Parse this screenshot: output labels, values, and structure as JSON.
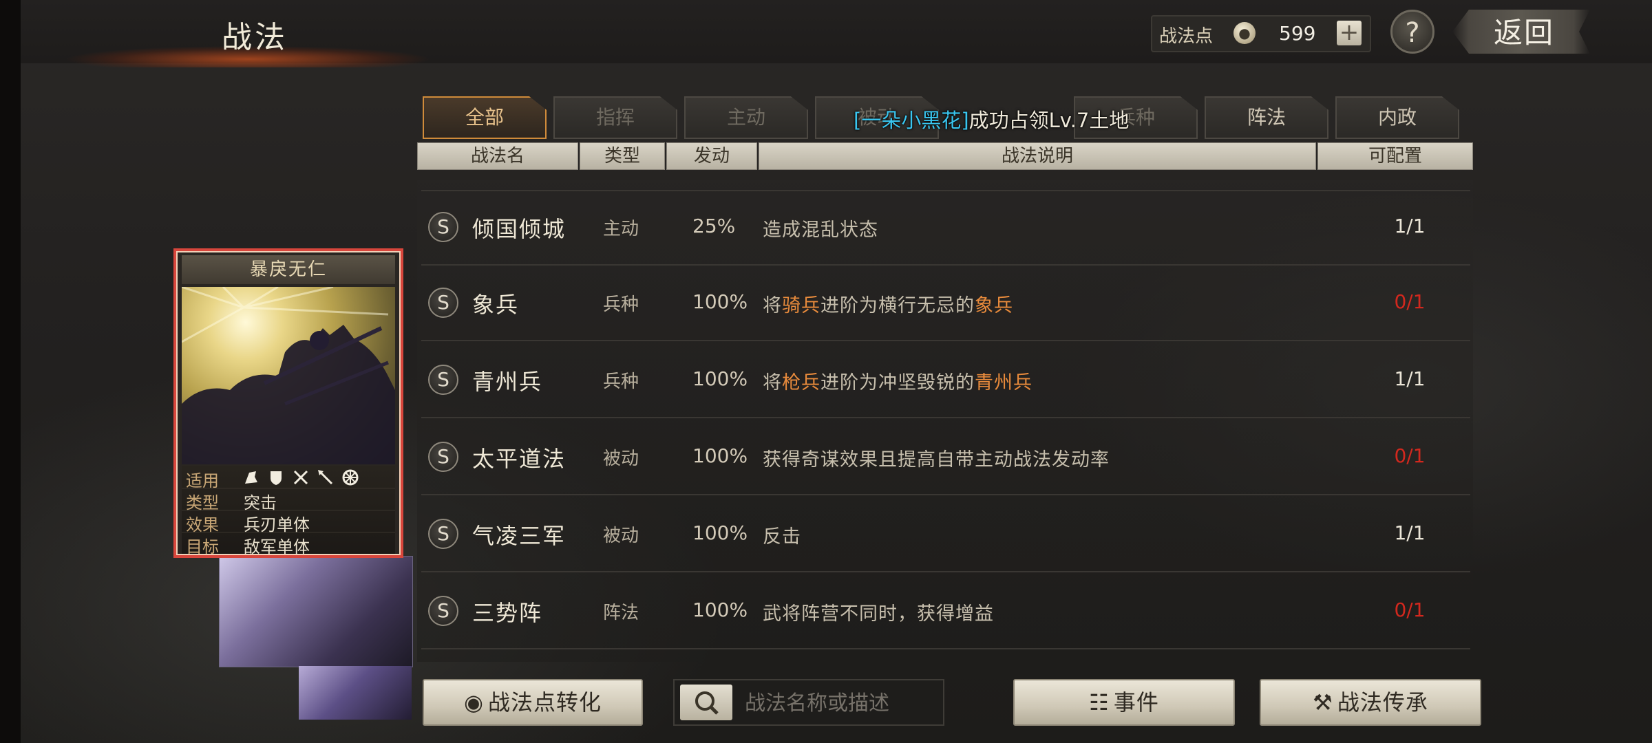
{
  "header": {
    "title": "战法",
    "points_label": "战法点",
    "points_icon": "flame-coin-icon",
    "points_value": "599",
    "back_label": "返回"
  },
  "tabs": [
    {
      "label": "全部",
      "active": true
    },
    {
      "label": "指挥",
      "active": false
    },
    {
      "label": "主动",
      "active": false
    },
    {
      "label": "被动",
      "active": false
    },
    {
      "label": "兵种",
      "active": false
    },
    {
      "label": "阵法",
      "active": false
    },
    {
      "label": "内政",
      "active": false
    }
  ],
  "toast": {
    "player": "[一朵小黑花]",
    "message": "成功占领Lv.7土地"
  },
  "columns": {
    "name": "战法名",
    "type": "类型",
    "rate": "发动",
    "desc": "战法说明",
    "count": "可配置"
  },
  "rows": [
    {
      "badge": "S",
      "name": "倾国倾城",
      "type": "主动",
      "rate": "25%",
      "desc_parts": [
        "造成混乱状态"
      ],
      "count": "1/1",
      "count_red": false
    },
    {
      "badge": "S",
      "name": "象兵",
      "type": "兵种",
      "rate": "100%",
      "desc_parts": [
        "将",
        "骑兵",
        "进阶为横行无忌的",
        "象兵"
      ],
      "count": "0/1",
      "count_red": true
    },
    {
      "badge": "S",
      "name": "青州兵",
      "type": "兵种",
      "rate": "100%",
      "desc_parts": [
        "将",
        "枪兵",
        "进阶为冲坚毁锐的",
        "青州兵"
      ],
      "count": "1/1",
      "count_red": false
    },
    {
      "badge": "S",
      "name": "太平道法",
      "type": "被动",
      "rate": "100%",
      "desc_parts": [
        "获得奇谋效果且提高自带主动战法发动率"
      ],
      "count": "0/1",
      "count_red": true
    },
    {
      "badge": "S",
      "name": "气凌三军",
      "type": "被动",
      "rate": "100%",
      "desc_parts": [
        "反击"
      ],
      "count": "1/1",
      "count_red": false
    },
    {
      "badge": "S",
      "name": "三势阵",
      "type": "阵法",
      "rate": "100%",
      "desc_parts": [
        "武将阵营不同时，获得增益"
      ],
      "count": "0/1",
      "count_red": true
    }
  ],
  "card": {
    "title": "暴戾无仁",
    "apply_label": "适用",
    "troop_icons": [
      "cavalry-icon",
      "shield-icon",
      "crossed-bows-icon",
      "spear-icon",
      "wheel-icon"
    ],
    "type_label": "类型",
    "type_value": "突击",
    "effect_label": "效果",
    "effect_value": "兵刃单体",
    "target_label": "目标",
    "target_value": "敌军单体"
  },
  "buttons": {
    "convert": "战法点转化",
    "search_placeholder": "战法名称或描述",
    "events": "事件",
    "inherit": "战法传承"
  },
  "colors": {
    "highlight": "#e98b3c",
    "red": "#d2281e",
    "toast_player": "#39c6f0",
    "tab_active": "#d08b3a"
  }
}
